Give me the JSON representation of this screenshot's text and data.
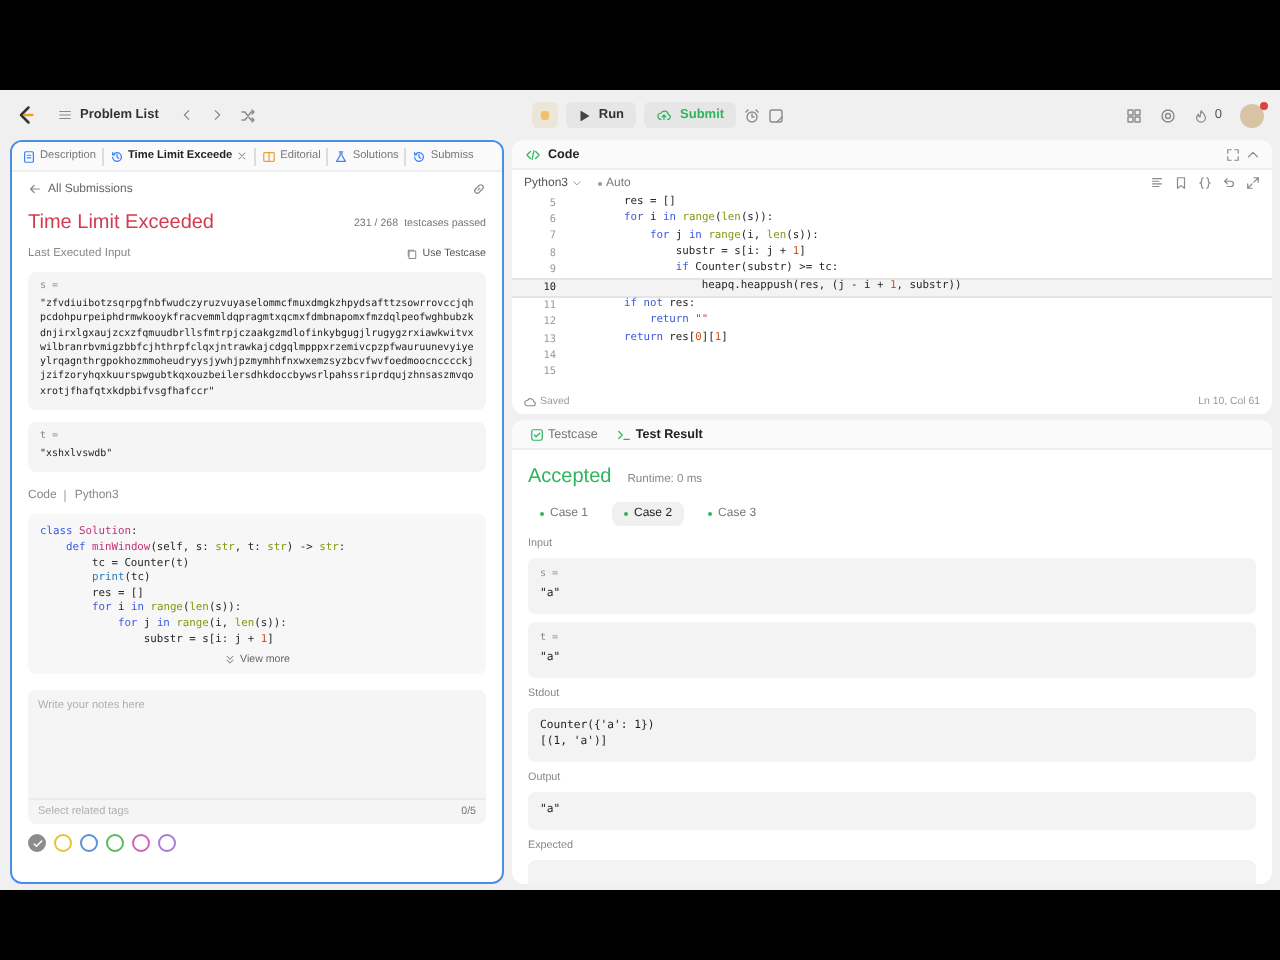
{
  "top_bar": {
    "problem_list": "Problem List",
    "run": "Run",
    "submit": "Submit",
    "streak": "0"
  },
  "left_panel": {
    "tabs": [
      {
        "kind": "description",
        "label": "Description",
        "selected": false,
        "closable": false
      },
      {
        "kind": "result",
        "label": "Time Limit Exceede",
        "selected": true,
        "closable": true
      },
      {
        "kind": "editorial",
        "label": "Editorial",
        "selected": false,
        "closable": false
      },
      {
        "kind": "solutions",
        "label": "Solutions",
        "selected": false,
        "closable": false
      },
      {
        "kind": "submissions",
        "label": "Submiss",
        "selected": false,
        "closable": false
      }
    ],
    "back_link": "All Submissions",
    "status": "Time Limit Exceeded",
    "passed": "231 / 268",
    "passed_label": "testcases passed",
    "input_label": "Last Executed Input",
    "use_testcase": "Use Testcase",
    "inputs": [
      {
        "name": "s =",
        "value": "\"zfvdiuibotzsqrpgfnbfwudczyruzvuyaselommcfmuxdmgkzhpydsafttzsowrrovccjqhpcdohpurpeiphdrmwkooykfracvemmldqpragmtxqcmxfdmbnapomxfmzdqlpeofwghbubzkdnjirxlgxaujzcxzfqmuudbrllsfmtrpjczaakgzmdlofinkybgugjlrugygzrxiawkwitvxwilbranrbvmigzbbfcjhthrpfclqxjntrawkajcdgqlmpppxrzemivcpzpfwauruunevyiyeylrqagnthrgpokhozmmoheudryysjywhjpzmymhhfnxwxemzsyzbcvfwvfoedmoocncccckjjzifzoryhqxkuurspwgubtkqxouzbeilersdhkdoccbywsrlpahssriprdqujzhnsaszmvqoxrotjfhafqtxkdpbifvsgfhafccr\""
      },
      {
        "name": "t =",
        "value": "\"xshxlvswdb\""
      }
    ],
    "code_label": "Code",
    "language": "Python3",
    "code": [
      [
        {
          "kind": "kw",
          "text": "class "
        },
        {
          "kind": "fn",
          "text": "Solution"
        },
        {
          "kind": "plain",
          "text": ":"
        }
      ],
      [
        {
          "kind": "kw",
          "text": "    def "
        },
        {
          "kind": "fn",
          "text": "minWindow"
        },
        {
          "kind": "plain",
          "text": "(self, s: "
        },
        {
          "kind": "type",
          "text": "str"
        },
        {
          "kind": "plain",
          "text": ", t: "
        },
        {
          "kind": "type",
          "text": "str"
        },
        {
          "kind": "plain",
          "text": ") -> "
        },
        {
          "kind": "type",
          "text": "str"
        },
        {
          "kind": "plain",
          "text": ":"
        }
      ],
      [
        {
          "kind": "plain",
          "text": "        tc = Counter(t)"
        }
      ],
      [
        {
          "kind": "builtin",
          "text": "        print"
        },
        {
          "kind": "plain",
          "text": "(tc)"
        }
      ],
      [
        {
          "kind": "plain",
          "text": "        res = []"
        }
      ],
      [
        {
          "kind": "kw",
          "text": "        for"
        },
        {
          "kind": "plain",
          "text": " i "
        },
        {
          "kind": "kw",
          "text": "in "
        },
        {
          "kind": "type",
          "text": "range"
        },
        {
          "kind": "plain",
          "text": "("
        },
        {
          "kind": "type",
          "text": "len"
        },
        {
          "kind": "plain",
          "text": "(s)):"
        }
      ],
      [
        {
          "kind": "kw",
          "text": "            for"
        },
        {
          "kind": "plain",
          "text": " j "
        },
        {
          "kind": "kw",
          "text": "in "
        },
        {
          "kind": "type",
          "text": "range"
        },
        {
          "kind": "plain",
          "text": "(i, "
        },
        {
          "kind": "type",
          "text": "len"
        },
        {
          "kind": "plain",
          "text": "(s)):"
        }
      ],
      [
        {
          "kind": "plain",
          "text": "                substr = s[i: j + "
        },
        {
          "kind": "num",
          "text": "1"
        },
        {
          "kind": "plain",
          "text": "]"
        }
      ]
    ],
    "view_more": "View more",
    "notes": {
      "placeholder": "Write your notes here",
      "tags_placeholder": "Select related tags",
      "tag_count": "0/5"
    },
    "colors": [
      {
        "color": "#8c8c8c",
        "selected": true
      },
      {
        "color": "#e6c13c",
        "selected": false
      },
      {
        "color": "#5b8fd6",
        "selected": false
      },
      {
        "color": "#5cb85c",
        "selected": false
      },
      {
        "color": "#d063b8",
        "selected": false
      },
      {
        "color": "#a77bd6",
        "selected": false
      }
    ]
  },
  "code_panel": {
    "title": "Code",
    "language": "Python3",
    "mode": "Auto",
    "lines": [
      {
        "number": "5",
        "current": false,
        "tokens": [
          {
            "kind": "plain",
            "text": "        res = []"
          }
        ]
      },
      {
        "number": "6",
        "current": false,
        "tokens": [
          {
            "kind": "kw",
            "text": "        for"
          },
          {
            "kind": "plain",
            "text": " i "
          },
          {
            "kind": "kw",
            "text": "in "
          },
          {
            "kind": "type",
            "text": "range"
          },
          {
            "kind": "plain",
            "text": "("
          },
          {
            "kind": "type",
            "text": "len"
          },
          {
            "kind": "plain",
            "text": "(s)):"
          }
        ]
      },
      {
        "number": "7",
        "current": false,
        "tokens": [
          {
            "kind": "kw",
            "text": "            for"
          },
          {
            "kind": "plain",
            "text": " j "
          },
          {
            "kind": "kw",
            "text": "in "
          },
          {
            "kind": "type",
            "text": "range"
          },
          {
            "kind": "plain",
            "text": "(i, "
          },
          {
            "kind": "type",
            "text": "len"
          },
          {
            "kind": "plain",
            "text": "(s)):"
          }
        ]
      },
      {
        "number": "8",
        "current": false,
        "tokens": [
          {
            "kind": "plain",
            "text": "                substr = s[i: j + "
          },
          {
            "kind": "num",
            "text": "1"
          },
          {
            "kind": "plain",
            "text": "]"
          }
        ]
      },
      {
        "number": "9",
        "current": false,
        "tokens": [
          {
            "kind": "kw",
            "text": "                if"
          },
          {
            "kind": "plain",
            "text": " Counter(substr) >= tc:"
          }
        ]
      },
      {
        "number": "10",
        "current": true,
        "tokens": [
          {
            "kind": "plain",
            "text": "                    heapq.heappush(res, (j - i + "
          },
          {
            "kind": "num",
            "text": "1"
          },
          {
            "kind": "plain",
            "text": ", substr))"
          }
        ]
      },
      {
        "number": "11",
        "current": false,
        "tokens": [
          {
            "kind": "kw",
            "text": "        if not"
          },
          {
            "kind": "plain",
            "text": " res:"
          }
        ]
      },
      {
        "number": "12",
        "current": false,
        "tokens": [
          {
            "kind": "kw",
            "text": "            return "
          },
          {
            "kind": "str",
            "text": "\"\""
          }
        ]
      },
      {
        "number": "13",
        "current": false,
        "tokens": [
          {
            "kind": "kw",
            "text": "        return"
          },
          {
            "kind": "plain",
            "text": " res["
          },
          {
            "kind": "num",
            "text": "0"
          },
          {
            "kind": "plain",
            "text": "]["
          },
          {
            "kind": "num",
            "text": "1"
          },
          {
            "kind": "plain",
            "text": "]"
          }
        ]
      },
      {
        "number": "14",
        "current": false
      },
      {
        "number": "15",
        "current": false
      }
    ],
    "saved": "Saved",
    "cursor": "Ln 10, Col 61"
  },
  "result_panel": {
    "tabs": [
      {
        "kind": "testcase",
        "label": "Testcase",
        "selected": false
      },
      {
        "kind": "terminal",
        "label": "Test Result",
        "selected": true
      }
    ],
    "verdict": "Accepted",
    "runtime": "Runtime: 0 ms",
    "cases": [
      {
        "label": "Case 1",
        "selected": false,
        "passed": true
      },
      {
        "label": "Case 2",
        "selected": true,
        "passed": true
      },
      {
        "label": "Case 3",
        "selected": false,
        "passed": true
      }
    ],
    "input_label": "Input",
    "inputs": [
      {
        "name": "s =",
        "value": "\"a\""
      },
      {
        "name": "t =",
        "value": "\"a\""
      }
    ],
    "stdout_label": "Stdout",
    "stdout": [
      "Counter({'a': 1})",
      "[(1, 'a')]"
    ],
    "output_label": "Output",
    "output": "\"a\"",
    "expected_label": "Expected"
  }
}
